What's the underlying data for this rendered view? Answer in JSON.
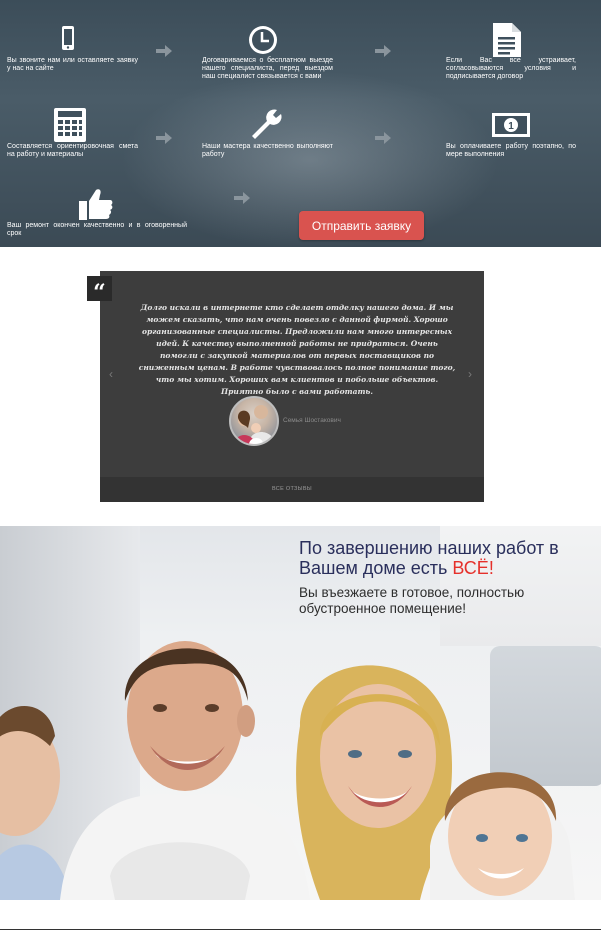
{
  "process": {
    "steps": [
      {
        "icon": "phone-icon",
        "text": "Вы звоните нам или оставляете заявку у нас на сайте"
      },
      {
        "icon": "clock-icon",
        "text": "Договариваемся о бесплатном выезде нашего специалиста, перед выездом наш специалист связывается с вами"
      },
      {
        "icon": "document-icon",
        "text": "Если Вас все устраивает, согласовываются условия и подписывается договор"
      },
      {
        "icon": "calculator-icon",
        "text": "Составляется ориентировочная смета на работу и материалы"
      },
      {
        "icon": "wrench-icon",
        "text": "Наши мастера качественно выполняют работу"
      },
      {
        "icon": "money-icon",
        "text": "Вы оплачиваете работу поэтапно, по мере выполнения"
      },
      {
        "icon": "thumbs-up-icon",
        "text": "Ваш ремонт окончен качественно и в оговоренный срок"
      }
    ],
    "cta_label": "Отправить заявку",
    "cta_color": "#d9534f"
  },
  "testimonial": {
    "quote_mark": "“",
    "text": "Долго искали в интернете кто сделает отделку нашего дома. И мы можем сказать, что нам очень повезло с данной фирмой. Хорошо организованные специалисты. Предложили нам много интересных идей. К качеству выполненной работы не придраться. Очень помогли с закупкой материалов от первых поставщиков по сниженным ценам. В работе чувствовалось полное понимание того, что мы хотим. Хороших вам клиентов и побольше объектов. Приятно было с вами работать.",
    "author": "Семья Шостакович",
    "all_reviews_label": "ВСЕ ОТЗЫВЫ",
    "prev_icon": "chevron-left-icon",
    "next_icon": "chevron-right-icon"
  },
  "hero": {
    "headline": "По завершению наших работ в Вашем доме есть ",
    "headline_accent": "ВСЁ!",
    "accent_color": "#e5302b",
    "subtitle": "Вы въезжаете в готовое, полностью обустроенное помещение!"
  }
}
